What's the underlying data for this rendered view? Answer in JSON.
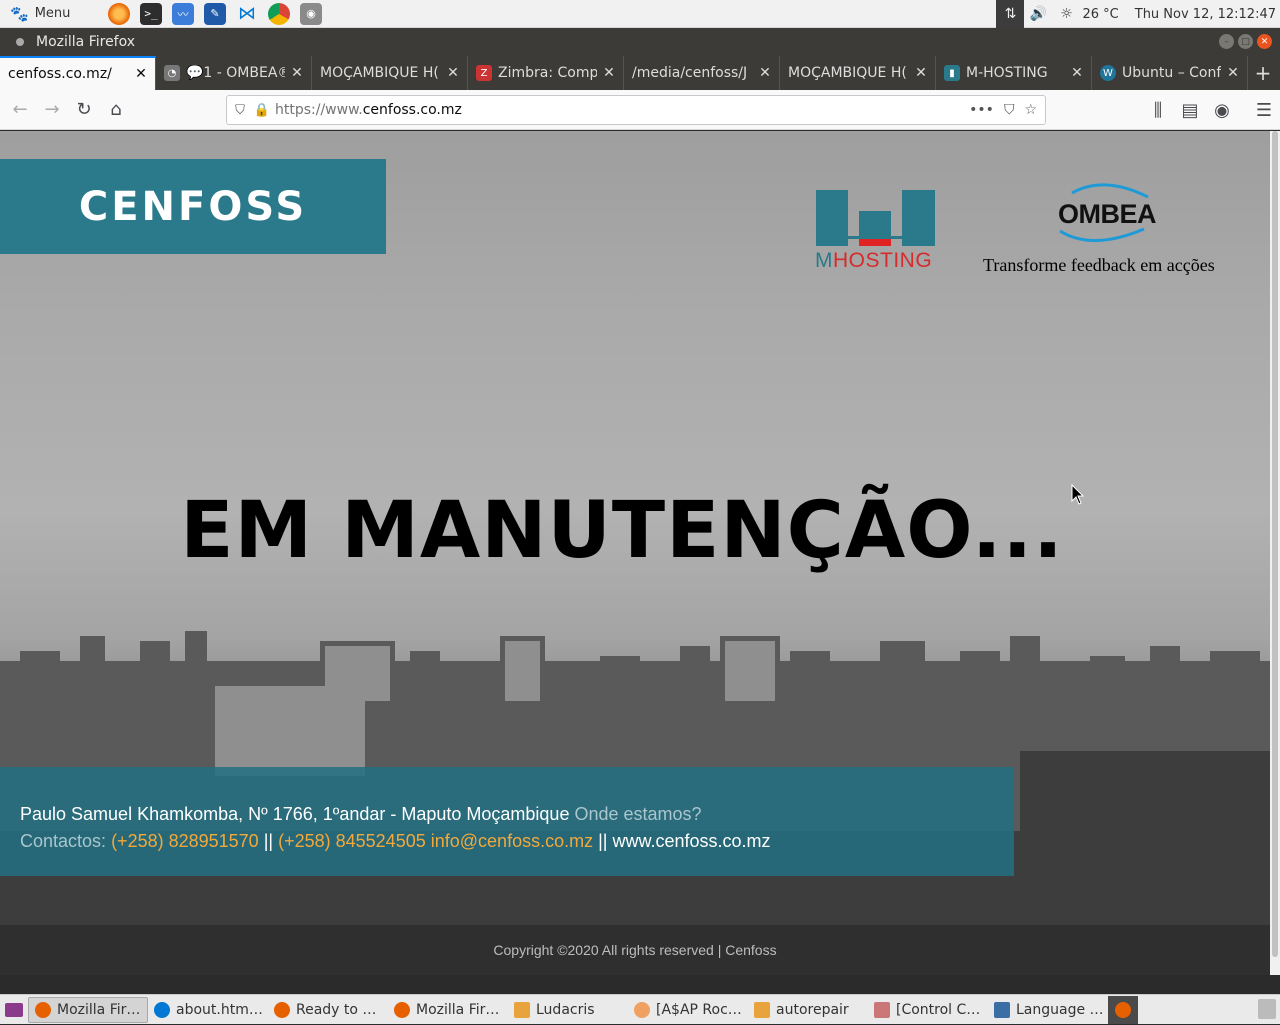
{
  "system": {
    "menu_label": "Menu",
    "temperature": "26 °C",
    "clock": "Thu Nov 12, 12:12:47",
    "launchers": [
      "firefox-icon",
      "terminal-icon",
      "monitor-icon",
      "editor-icon",
      "vscode-icon",
      "chrome-icon",
      "screenshot-icon"
    ]
  },
  "window": {
    "title": "Mozilla Firefox"
  },
  "tabs": [
    {
      "label": "cenfoss.co.mz/",
      "active": true,
      "favicon": ""
    },
    {
      "label": "💬1 - OMBEA®",
      "favicon": "chat-icon",
      "color": "#666"
    },
    {
      "label": "MOÇAMBIQUE H(",
      "favicon": ""
    },
    {
      "label": "Zimbra: Comp",
      "favicon": "zimbra-icon",
      "color": "#c33"
    },
    {
      "label": "/media/cenfoss/J",
      "favicon": ""
    },
    {
      "label": "MOÇAMBIQUE H(",
      "favicon": ""
    },
    {
      "label": "M-HOSTING",
      "favicon": "mhosting-icon",
      "color": "#2b7a8c"
    },
    {
      "label": "Ubuntu – Conf",
      "favicon": "wordpress-icon",
      "color": "#21759b"
    }
  ],
  "url": {
    "prefix": "https://www.",
    "domain": "cenfoss.co.mz"
  },
  "page": {
    "brand": "CENFOSS",
    "mhosting_m": "M",
    "mhosting_rest": "HOSTING",
    "ombea_name": "OMBEA",
    "ombea_tagline": "Transforme feedback em acções",
    "headline": "EM MANUTENÇÃO...",
    "address": "Paulo Samuel Khamkomba, Nº 1766, 1ºandar - Maputo Moçambique",
    "where_link": "Onde estamos?",
    "contacts_label": "Contactos:",
    "phone1": "(+258) 828951570",
    "sep1": "||",
    "phone2": "(+258) 845524505",
    "email": "info@cenfoss.co.mz",
    "sep2": "||",
    "website": "www.cenfoss.co.mz",
    "copyright": "Copyright ©2020 All rights reserved | Cenfoss"
  },
  "taskbar": [
    {
      "label": "Mozilla Fir…",
      "active": true,
      "color": "#e66000"
    },
    {
      "label": "about.htm…",
      "color": "#0078d4"
    },
    {
      "label": "Ready to …",
      "color": "#e66000"
    },
    {
      "label": "Mozilla Fir…",
      "color": "#e66000"
    },
    {
      "label": "Ludacris",
      "color": "#e8a33d"
    },
    {
      "label": "[A$AP Roc…",
      "color": "#f0a060"
    },
    {
      "label": "autorepair",
      "color": "#e8a33d"
    },
    {
      "label": "[Control C…",
      "color": "#c77"
    },
    {
      "label": "Language …",
      "color": "#3b6ea5"
    }
  ]
}
